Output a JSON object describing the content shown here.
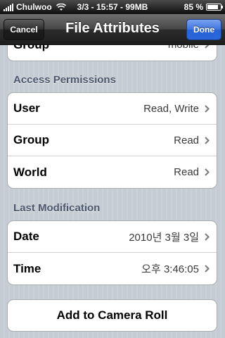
{
  "status_bar": {
    "carrier": "Chulwoo",
    "center": "3/3 - 15:57 - 99MB",
    "battery": "85 %",
    "battery_level": 0.85
  },
  "nav": {
    "title": "File Attributes",
    "cancel_label": "Cancel",
    "done_label": "Done"
  },
  "top_partial_row": {
    "label": "Group",
    "value": "mobile"
  },
  "access_permissions": {
    "header": "Access Permissions",
    "rows": [
      {
        "label": "User",
        "value": "Read, Write"
      },
      {
        "label": "Group",
        "value": "Read"
      },
      {
        "label": "World",
        "value": "Read"
      }
    ]
  },
  "last_modification": {
    "header": "Last Modification",
    "rows": [
      {
        "label": "Date",
        "value": "2010년 3월 3일"
      },
      {
        "label": "Time",
        "value": "오후 3:46:05"
      }
    ]
  },
  "actions": {
    "add_to_camera_roll": "Add to Camera Roll"
  },
  "colors": {
    "section_header": "#4c566c",
    "done_button": "#2863d8",
    "background": "#c5ccd4"
  }
}
